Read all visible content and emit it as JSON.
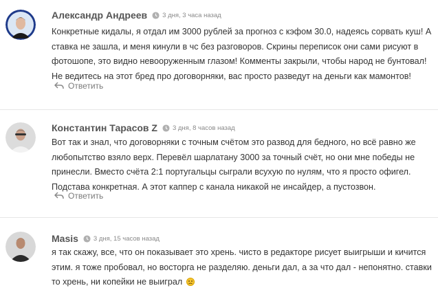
{
  "comments": [
    {
      "author": "Александр Андреев",
      "time": "3 дня, 3 часа назад",
      "text": "Конкретные кидалы, я отдал им 3000 рублей за прогноз с кэфом 30.0, надеясь сорвать куш! А ставка не зашла, и меня кинули в чс без разговоров. Скрины переписок они сами рисуют в фотошопе, это видно невооруженным глазом! Комменты закрыли, чтобы народ не бунтовал! Не ведитесь на этот бред про договорняки, вас просто разведут на деньги как мамонтов!",
      "reply_label": "Ответить"
    },
    {
      "author": "Константин Тарасов Z",
      "time": "3 дня, 8 часов назад",
      "text": "Вот так и знал, что договорняки с точным счётом это развод для бедного, но всё равно же любопытство взяло верх. Перевёл шарлатану 3000 за точный счёт, но они мне победы не принесли. Вместо счёта 2:1 португальцы сыграли всухую по нулям, что я просто офигел. Подстава конкретная. А этот каппер с канала никакой не инсайдер, а пустозвон.",
      "reply_label": "Ответить"
    },
    {
      "author": "Masis",
      "time": "3 дня, 15 часов назад",
      "text": "я так скажу, все, что он показывает это хрень. чисто в редакторе рисует выигрыши и кичится этим. я тоже пробовал, но восторга не разделяю. деньги дал, а за что дал - непонятно. ставки то хрень, ни копейки не выиграл",
      "emoji": "confused-face-emoji"
    }
  ],
  "icons": {
    "clock": "clock-icon",
    "reply": "reply-arrow-icon"
  }
}
